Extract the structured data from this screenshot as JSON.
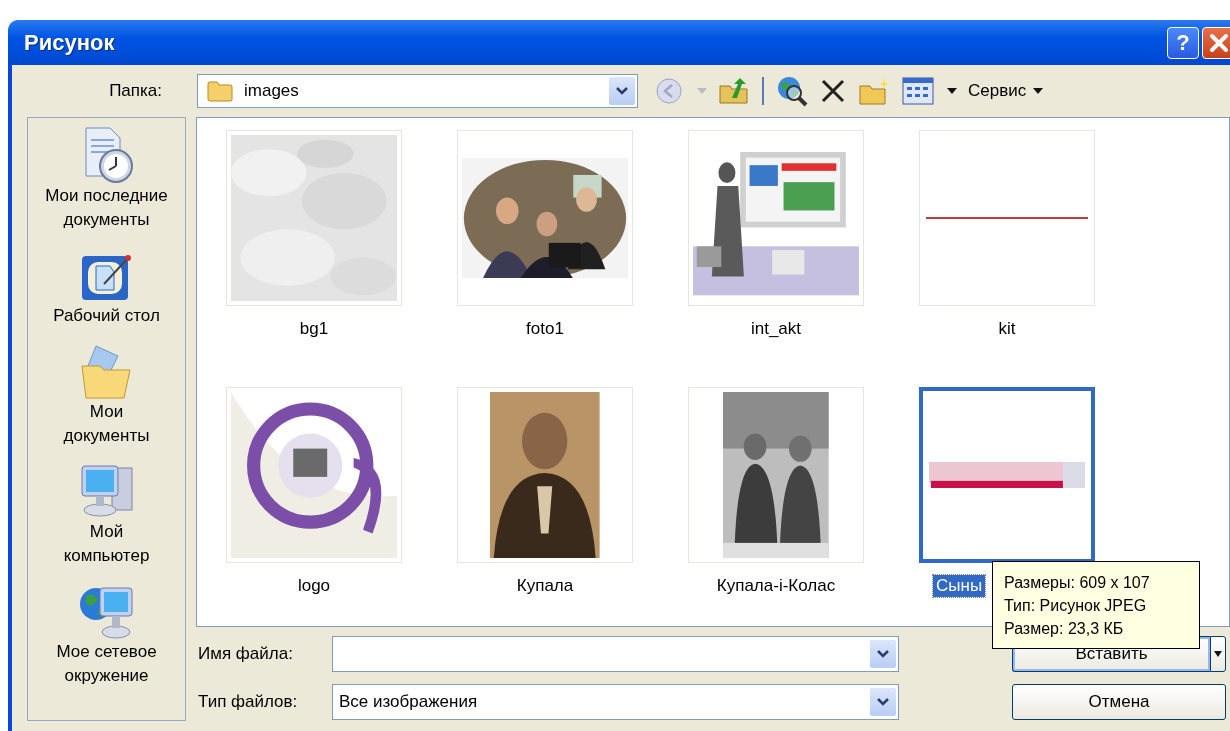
{
  "window": {
    "title": "Рисунок",
    "help_button": "?"
  },
  "toolbar": {
    "folder_label": "Папка:",
    "folder": "images",
    "back_button": {
      "disabled": true
    },
    "menu": "Сервис"
  },
  "places": [
    {
      "label": "Мои последние\nдокументы",
      "selected": false
    },
    {
      "label": "Рабочий стол",
      "selected": false
    },
    {
      "label": "Мои\nдокументы",
      "selected": false
    },
    {
      "label": "Мой\nкомпьютер",
      "selected": false
    },
    {
      "label": "Мое сетевое\nокружение",
      "selected": false
    }
  ],
  "files": [
    {
      "label": "bg1",
      "selected": false,
      "kind": "picture"
    },
    {
      "label": "foto1",
      "selected": false,
      "kind": "picture"
    },
    {
      "label": "int_akt",
      "selected": false,
      "kind": "picture"
    },
    {
      "label": "kit",
      "selected": false,
      "kind": "picture"
    },
    {
      "label": "logo",
      "selected": false,
      "kind": "picture"
    },
    {
      "label": "Купала",
      "selected": false,
      "kind": "picture"
    },
    {
      "label": "Купала-і-Колас",
      "selected": false,
      "kind": "picture"
    },
    {
      "label": "Сыны",
      "selected": true,
      "kind": "picture"
    }
  ],
  "tooltip": [
    "Размеры: 609 x 107",
    "Тип: Рисунок JPEG",
    "Размер: 23,3 КБ"
  ],
  "file_name": {
    "label": "Имя файла:"
  },
  "file_type": {
    "label": "Тип файлов:",
    "value": "Все изображения"
  },
  "buttons": [
    {
      "label": "Вставить",
      "kind": "split"
    },
    {
      "label": "Отмена",
      "kind": "plain"
    }
  ]
}
